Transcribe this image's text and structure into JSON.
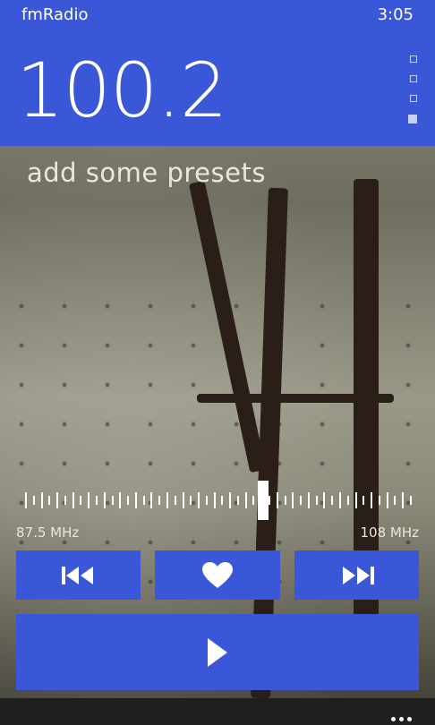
{
  "status": {
    "app_title": "fmRadio",
    "time": "3:05"
  },
  "header": {
    "frequency": "100.2",
    "bg_color": "#3a57d8"
  },
  "pivot_pages": {
    "count": 4,
    "active_index": 3
  },
  "presets": {
    "empty_text": "add some presets"
  },
  "tuner": {
    "min_label": "87.5 MHz",
    "max_label": "108 MHz",
    "min_mhz": 87.5,
    "max_mhz": 108,
    "current_mhz": 100.2
  },
  "controls": {
    "previous_icon": "skip-previous-icon",
    "favorite_icon": "heart-icon",
    "next_icon": "skip-next-icon",
    "play_icon": "play-icon"
  },
  "appbar": {
    "more_icon": "ellipsis-icon"
  }
}
